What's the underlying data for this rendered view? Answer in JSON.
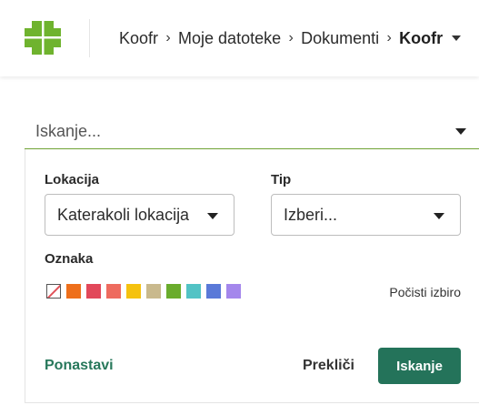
{
  "header": {
    "logo_icon": "koofr-logo-icon",
    "logo_color": "#6fb32e",
    "breadcrumb": [
      "Koofr",
      "Moje datoteke",
      "Dokumenti"
    ],
    "separator": "›",
    "current": "Koofr"
  },
  "search": {
    "placeholder": "Iskanje...",
    "value": "",
    "underline_color": "#6fa335"
  },
  "filters": {
    "location_label": "Lokacija",
    "location_value": "Katerakoli lokacija",
    "type_label": "Tip",
    "type_value": "Izberi...",
    "tag_label": "Oznaka",
    "tag_colors": [
      "none",
      "#ee6f1b",
      "#e2485a",
      "#ee6b5f",
      "#f5c20f",
      "#c9b98d",
      "#6aac2c",
      "#52c3c5",
      "#5a79d8",
      "#a487ec"
    ],
    "clear_label": "Počisti izbiro"
  },
  "actions": {
    "reset_label": "Ponastavi",
    "cancel_label": "Prekliči",
    "search_label": "Iskanje",
    "primary_color": "#24735a"
  }
}
